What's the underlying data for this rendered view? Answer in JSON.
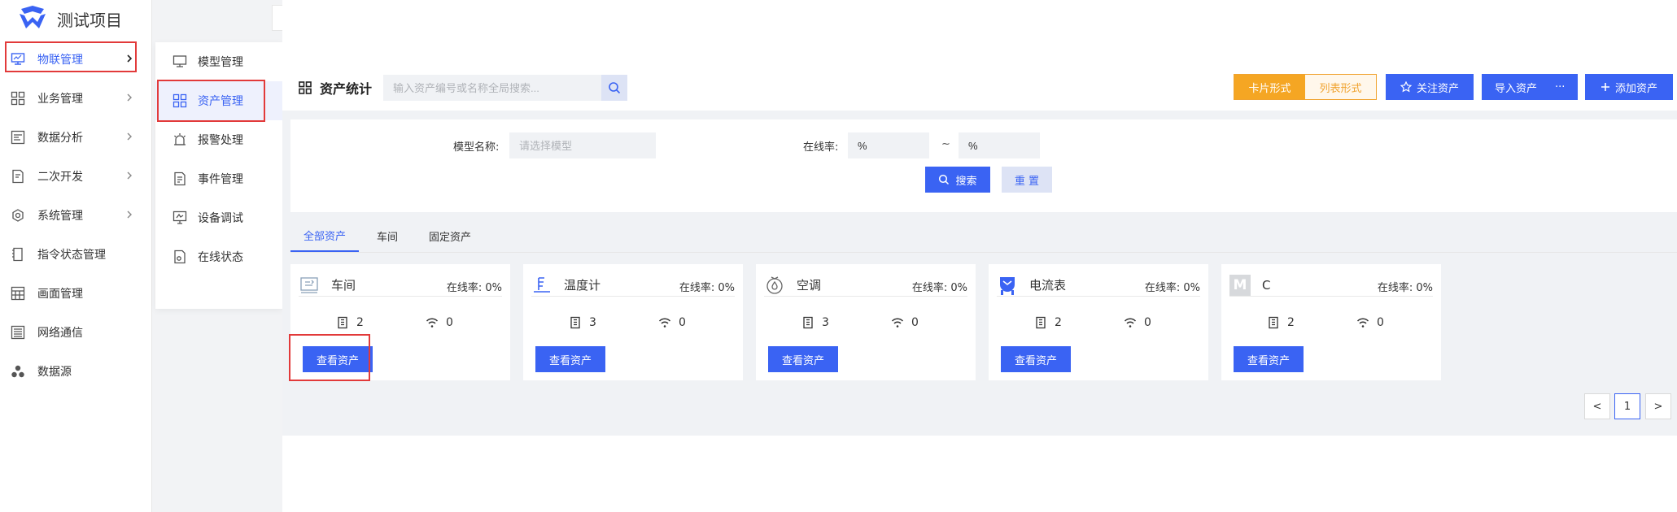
{
  "app": {
    "title": "测试项目",
    "accent": "#3a63f3",
    "warning": "#f5a623",
    "highlight": "#e23a3a"
  },
  "sidebar": {
    "items": [
      {
        "label": "物联管理",
        "icon": "iot-monitor-icon",
        "has_arrow": true,
        "active": true
      },
      {
        "label": "业务管理",
        "icon": "grid-icon",
        "has_arrow": true
      },
      {
        "label": "数据分析",
        "icon": "report-icon",
        "has_arrow": true
      },
      {
        "label": "二次开发",
        "icon": "code-doc-icon",
        "has_arrow": true
      },
      {
        "label": "系统管理",
        "icon": "gear-icon",
        "has_arrow": true
      },
      {
        "label": "指令状态管理",
        "icon": "command-doc-icon",
        "has_arrow": false
      },
      {
        "label": "画面管理",
        "icon": "screen-grid-icon",
        "has_arrow": false
      },
      {
        "label": "网络通信",
        "icon": "list-lines-icon",
        "has_arrow": false
      },
      {
        "label": "数据源",
        "icon": "data-source-icon",
        "has_arrow": false
      }
    ]
  },
  "submenu": {
    "items": [
      {
        "label": "模型管理",
        "icon": "monitor-icon"
      },
      {
        "label": "资产管理",
        "icon": "grid-icon",
        "active": true
      },
      {
        "label": "报警处理",
        "icon": "alarm-icon"
      },
      {
        "label": "事件管理",
        "icon": "event-doc-icon"
      },
      {
        "label": "设备调试",
        "icon": "debug-screen-icon"
      },
      {
        "label": "在线状态",
        "icon": "online-doc-icon"
      }
    ]
  },
  "header": {
    "title": "资产统计",
    "search_placeholder": "输入资产编号或名称全局搜索...",
    "view_card": "卡片形式",
    "view_list": "列表形式",
    "follow_btn": "关注资产",
    "import_btn": "导入资产",
    "more": "···",
    "add_btn": "添加资产"
  },
  "filters": {
    "model_label": "模型名称:",
    "model_placeholder": "请选择模型",
    "rate_label": "在线率:",
    "rate_min": "%",
    "rate_sep": "~",
    "rate_max": "%",
    "search_btn": "搜索",
    "reset_btn": "重 置"
  },
  "tabs": [
    {
      "label": "全部资产",
      "active": true
    },
    {
      "label": "车间"
    },
    {
      "label": "固定资产"
    }
  ],
  "cards": [
    {
      "name": "车间",
      "rate_label": "在线率:",
      "rate": "0%",
      "count": "2",
      "online": "0",
      "btn": "查看资产",
      "icon": "workshop-icon"
    },
    {
      "name": "温度计",
      "rate_label": "在线率:",
      "rate": "0%",
      "count": "3",
      "online": "0",
      "btn": "查看资产",
      "icon": "thermometer-icon"
    },
    {
      "name": "空调",
      "rate_label": "在线率:",
      "rate": "0%",
      "count": "3",
      "online": "0",
      "btn": "查看资产",
      "icon": "air-conditioner-icon"
    },
    {
      "name": "电流表",
      "rate_label": "在线率:",
      "rate": "0%",
      "count": "2",
      "online": "0",
      "btn": "查看资产",
      "icon": "ammeter-icon"
    },
    {
      "name": "C",
      "rate_label": "在线率:",
      "rate": "0%",
      "count": "2",
      "online": "0",
      "btn": "查看资产",
      "icon": "letter-m-icon",
      "icon_letter": "M"
    }
  ],
  "pagination": {
    "prev": "<",
    "current": "1",
    "next": ">"
  }
}
